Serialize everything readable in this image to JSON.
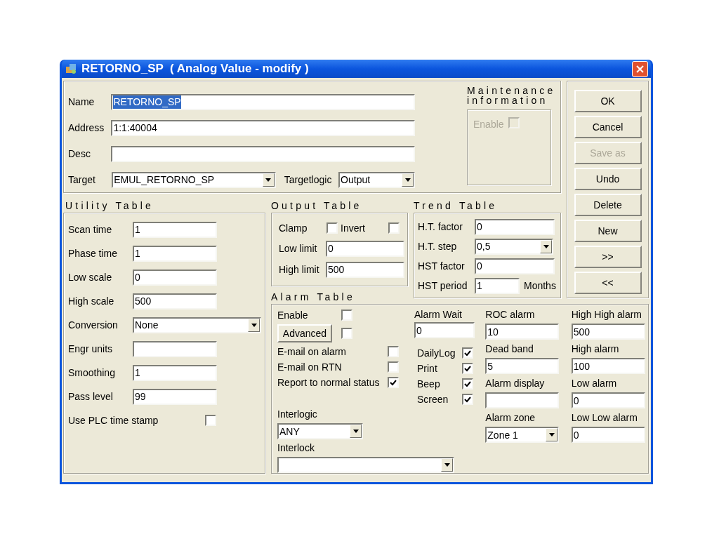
{
  "window": {
    "title": "RETORNO_SP  ( Analog Value - modify )"
  },
  "top": {
    "fields": [
      {
        "label": "Name",
        "value": "RETORNO_SP",
        "highlighted": true
      },
      {
        "label": "Address",
        "value": "1:1:40004"
      },
      {
        "label": "Desc"
      }
    ],
    "target": {
      "label": "Target",
      "value": "EMUL_RETORNO_SP"
    },
    "targetlogic": {
      "label": "Targetlogic",
      "value": "Output"
    }
  },
  "maintenance": {
    "title_lines": [
      "Maintenance",
      "information"
    ],
    "enable": {
      "label": "Enable",
      "checked": false,
      "disabled": true
    }
  },
  "buttons": [
    {
      "label": "OK",
      "disabled": false
    },
    {
      "label": "Cancel",
      "disabled": false
    },
    {
      "label": "Save as",
      "disabled": true
    },
    {
      "label": "Undo",
      "disabled": false
    },
    {
      "label": "Delete",
      "disabled": false
    },
    {
      "label": "New",
      "disabled": false
    },
    {
      "label": ">>",
      "disabled": false
    },
    {
      "label": "<<",
      "disabled": false
    }
  ],
  "utility": {
    "title": "Utility Table",
    "rows": [
      {
        "kind": "text",
        "label": "Scan time",
        "value": "1"
      },
      {
        "kind": "text",
        "label": "Phase time",
        "value": "1"
      },
      {
        "kind": "text",
        "label": "Low scale",
        "value": "0"
      },
      {
        "kind": "text",
        "label": "High scale",
        "value": "500"
      },
      {
        "kind": "dropdown",
        "label": "Conversion",
        "value": "None"
      },
      {
        "kind": "text",
        "label": "Engr units"
      },
      {
        "kind": "text",
        "label": "Smoothing",
        "value": "1"
      },
      {
        "kind": "text",
        "label": "Pass level",
        "value": "99"
      },
      {
        "kind": "checkbox",
        "label": "Use PLC time stamp",
        "checked": false
      }
    ]
  },
  "output": {
    "title": "Output Table",
    "checks": [
      {
        "label": "Clamp",
        "checked": false
      },
      {
        "label": "Invert",
        "checked": false
      }
    ],
    "fields": [
      {
        "label": "Low limit",
        "value": "0"
      },
      {
        "label": "High limit",
        "value": "500"
      }
    ]
  },
  "trend": {
    "title": "Trend Table",
    "rows": [
      {
        "kind": "text",
        "label": "H.T. factor",
        "value": "0"
      },
      {
        "kind": "dropdown",
        "label": "H.T. step",
        "value": "0,5"
      },
      {
        "kind": "text",
        "label": "HST factor",
        "value": "0"
      },
      {
        "kind": "text",
        "label": "HST period",
        "value": "1",
        "unit": "Months"
      }
    ]
  },
  "alarm": {
    "title": "Alarm Table",
    "enable": {
      "label": "Enable",
      "checked": false
    },
    "advanced": {
      "label": "Advanced",
      "checked": false
    },
    "left_checks": [
      {
        "label": "E-mail on alarm",
        "checked": false
      },
      {
        "label": "E-mail on RTN",
        "checked": false
      },
      {
        "label": "Report to normal status",
        "checked": true
      }
    ],
    "interlogic": {
      "label": "Interlogic",
      "value": "ANY"
    },
    "interlock": {
      "label": "Interlock"
    },
    "alarm_wait": {
      "label": "Alarm Wait",
      "value": "0"
    },
    "right_checks": [
      {
        "label": "DailyLog",
        "checked": true
      },
      {
        "label": "Print",
        "checked": true
      },
      {
        "label": "Beep",
        "checked": true
      },
      {
        "label": "Screen",
        "checked": true
      }
    ],
    "column_3": [
      {
        "kind": "text",
        "label": "ROC alarm",
        "value": "10"
      },
      {
        "kind": "text",
        "label": "Dead band",
        "value": "5"
      },
      {
        "kind": "text",
        "label": "Alarm display"
      },
      {
        "kind": "dropdown",
        "label": "Alarm zone",
        "value": "Zone 1"
      }
    ],
    "column_4": [
      {
        "kind": "text",
        "label": "High High alarm",
        "value": "500"
      },
      {
        "kind": "text",
        "label": "High alarm",
        "value": "100"
      },
      {
        "kind": "text",
        "label": "Low alarm",
        "value": "0"
      },
      {
        "kind": "text",
        "label": "Low Low alarm",
        "value": "0"
      }
    ]
  }
}
